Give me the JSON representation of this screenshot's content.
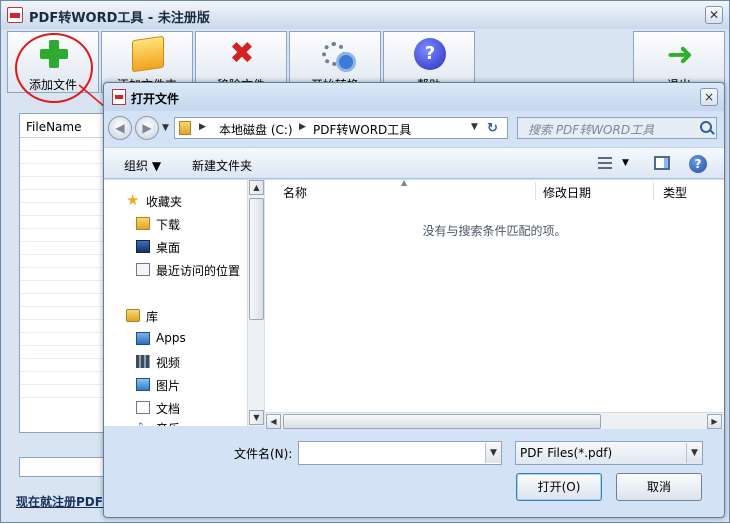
{
  "app": {
    "title": "PDF转WORD工具 - 未注册版",
    "toolbar": {
      "add_file": "添加文件",
      "add_folder": "添加文件夹",
      "remove_file": "移除文件",
      "start_convert": "开始转换",
      "help": "帮助",
      "exit": "退出"
    },
    "file_list": {
      "header": "FileName"
    },
    "register_link": "现在就注册PDF"
  },
  "dialog": {
    "title": "打开文件",
    "close": "×",
    "address": {
      "back": "◀",
      "forward": "▶",
      "path_parts": [
        "本地磁盘 (C:)",
        "PDF转WORD工具"
      ],
      "separator": "▶",
      "refresh": "↻"
    },
    "search": {
      "placeholder": "搜索 PDF转WORD工具"
    },
    "commands": {
      "organize": "组织 ▼",
      "new_folder": "新建文件夹",
      "help": "?"
    },
    "nav": {
      "favorites_label": "收藏夹",
      "favorites": [
        "下载",
        "桌面",
        "最近访问的位置"
      ],
      "library_label": "库",
      "libraries": [
        "Apps",
        "视频",
        "图片",
        "文档",
        "音乐"
      ]
    },
    "columns": {
      "name": "名称",
      "modified": "修改日期",
      "type": "类型"
    },
    "empty_message": "没有与搜索条件匹配的项。",
    "filename": {
      "label": "文件名(N):",
      "value": ""
    },
    "filetype": {
      "selected": "PDF Files(*.pdf)"
    },
    "buttons": {
      "open": "打开(O)",
      "cancel": "取消"
    }
  },
  "colors": {
    "annotation": "#e01818",
    "title_bar": "#c9d8ea",
    "accent": "#2f5fa7"
  }
}
